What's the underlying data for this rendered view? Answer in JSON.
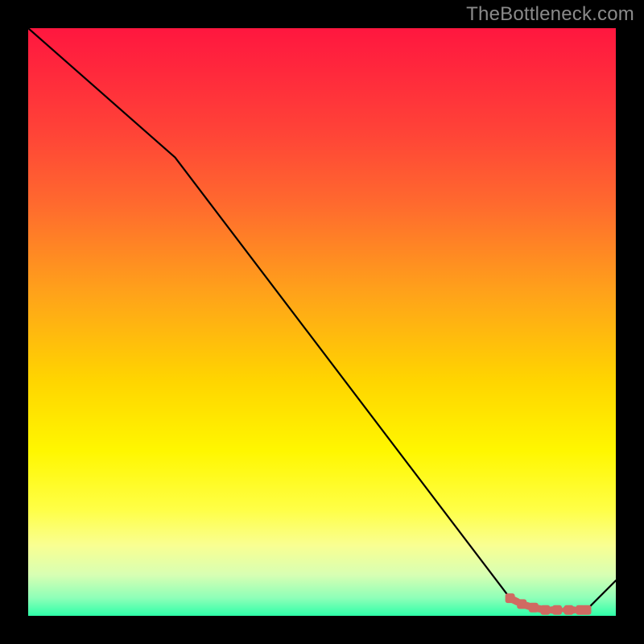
{
  "watermark": "TheBottleneck.com",
  "chart_data": {
    "type": "line",
    "title": "",
    "xlabel": "",
    "ylabel": "",
    "xlim": [
      0,
      100
    ],
    "ylim": [
      0,
      100
    ],
    "series": [
      {
        "name": "curve",
        "x": [
          0,
          25,
          82,
          88,
          95,
          100
        ],
        "values": [
          100,
          78,
          3,
          1,
          1,
          6
        ]
      }
    ],
    "marker_series": {
      "name": "highlight",
      "color": "#d06a62",
      "x": [
        82,
        84,
        86,
        88,
        90,
        92,
        94,
        95
      ],
      "values": [
        3.0,
        2.0,
        1.4,
        1.0,
        1.0,
        1.0,
        1.0,
        1.0
      ]
    },
    "background": "rainbow-gradient",
    "axes_visible": false
  }
}
